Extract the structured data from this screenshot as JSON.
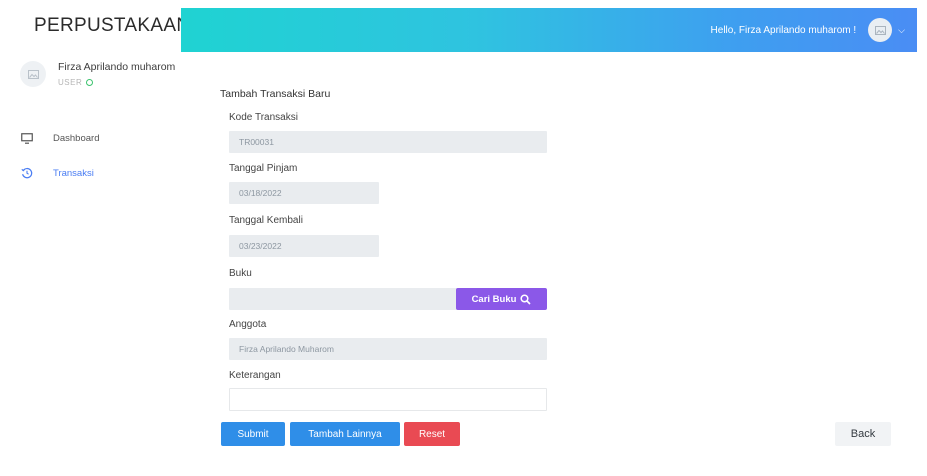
{
  "brand": {
    "title": "PERPUSTAKAAN"
  },
  "header": {
    "greeting": "Hello, Firza Aprilando muharom !"
  },
  "profile": {
    "name": "Firza Aprilando muharom",
    "role": "USER"
  },
  "sidebar": {
    "items": [
      {
        "label": "Dashboard",
        "icon": "monitor-icon"
      },
      {
        "label": "Transaksi",
        "icon": "history-icon",
        "active": true
      }
    ]
  },
  "form": {
    "title": "Tambah Transaksi Baru",
    "kode": {
      "label": "Kode Transaksi",
      "value": "TR00031"
    },
    "tanggal_pinjam": {
      "label": "Tanggal Pinjam",
      "value": "03/18/2022"
    },
    "tanggal_kembali": {
      "label": "Tanggal Kembali",
      "value": "03/23/2022"
    },
    "buku": {
      "label": "Buku",
      "value": "",
      "button": "Cari Buku"
    },
    "anggota": {
      "label": "Anggota",
      "value": "Firza Aprilando Muharom"
    },
    "keterangan": {
      "label": "Keterangan",
      "value": ""
    }
  },
  "actions": {
    "submit": "Submit",
    "tambah": "Tambah Lainnya",
    "reset": "Reset",
    "back": "Back"
  },
  "colors": {
    "primary": "#2f8ee8",
    "purple": "#8b58e8",
    "danger": "#e94a53",
    "header_start": "#1fd3d2",
    "header_end": "#4a8df4"
  }
}
